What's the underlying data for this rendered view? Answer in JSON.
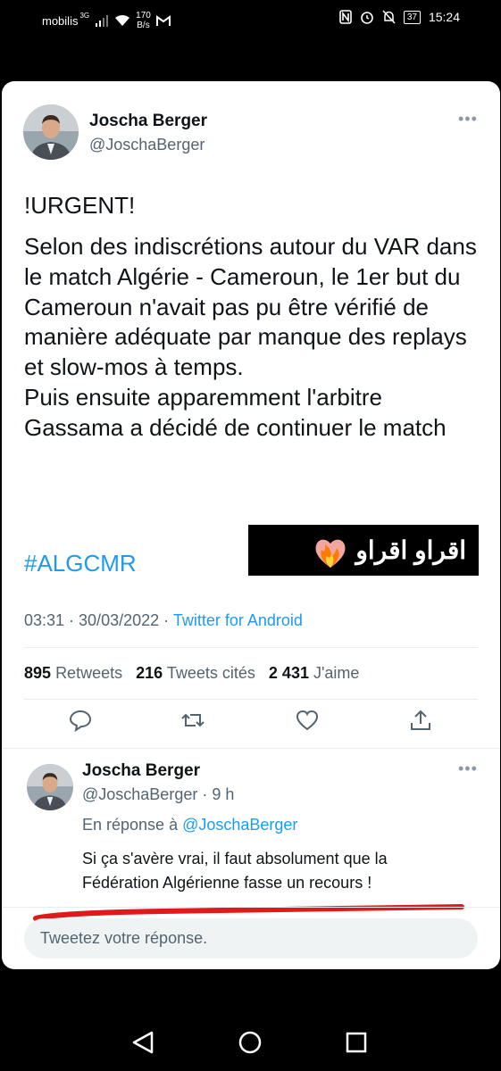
{
  "status_bar": {
    "carrier": "mobilis",
    "network": "3G",
    "speed_value": "170",
    "speed_unit": "B/s",
    "battery": "37",
    "time": "15:24"
  },
  "tweet": {
    "author_name": "Joscha Berger",
    "author_handle": "@JoschaBerger",
    "urgent": "!URGENT!",
    "body": "Selon des indiscrétions autour du VAR dans le match Algérie - Cameroun, le 1er but du Cameroun n'avait pas pu être vérifié de manière adéquate par manque des replays et slow-mos à temps.\nPuis ensuite apparemment l'arbitre Gassama a décidé de continuer le match",
    "hashtag": "#ALGCMR",
    "timestamp": "03:31 · 30/03/2022 · ",
    "client": "Twitter for Android",
    "retweets_count": "895",
    "retweets_label": "Retweets",
    "quotes_count": "216",
    "quotes_label": "Tweets cités",
    "likes_count": "2 431",
    "likes_label": "J'aime"
  },
  "overlay_text": "اقراو اقراو",
  "reply": {
    "author_name": "Joscha Berger",
    "author_handle": "@JoschaBerger · 9 h",
    "in_reply_prefix": "En réponse à ",
    "in_reply_to": "@JoschaBerger",
    "text": "Si ça s'avère vrai, il faut absolument que la Fédération Algérienne fasse un recours !"
  },
  "compose": {
    "placeholder": "Tweetez votre réponse."
  },
  "colors": {
    "link": "#1d9bf0",
    "annotation_red": "#e0191b"
  }
}
